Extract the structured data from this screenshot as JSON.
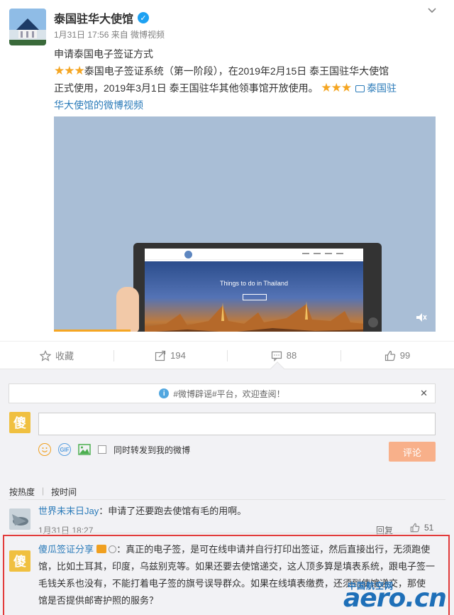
{
  "post": {
    "author": "泰国驻华大使馆",
    "meta": "1月31日 17:56 来自 微博视频",
    "title": "申请泰国电子签证方式",
    "text_line1": "泰国电子签证系统（第一阶段），在2019年2月15日 泰王国驻华大使馆",
    "text_line2": "正式使用，2019年3月1日 泰王国驻华其他领事馆开放使用。",
    "video_link_1": "泰国驻",
    "video_link_2": "华大使馆的微博视频",
    "video_hero_text": "Things to do in Thailand",
    "video_progress_fraction": 0.2
  },
  "actions": {
    "favorite": "收藏",
    "repost": "194",
    "comment": "88",
    "like": "99"
  },
  "comment_box": {
    "notice": "#微博辟谣#平台，欢迎查阅！",
    "sync_label": "同时转发到我的微博",
    "submit": "评论",
    "avatar_char": "傻"
  },
  "sort": {
    "hot": "按热度",
    "time": "按时间"
  },
  "comments": [
    {
      "user": "世界未末日Jay",
      "text": "：申请了还要跑去使馆有毛的用啊。",
      "time": "1月31日 18:27",
      "reply": "回复",
      "likes": "51"
    },
    {
      "user": "傻瓜签证分享",
      "avatar_char": "傻",
      "line1": "：真正的电子签，是可在线申请并自行打印出签证，然后直接出行，无须跑使",
      "line2": "馆，比如土耳其，印度，乌兹别克等。如果还要去使馆递交，这人顶多算是填表系统，跟电子签一",
      "line3": "毛钱关系也没有，不能打着电子签的旗号误导群众。如果在线填表缴费，还须到使馆递交，那使",
      "line4": "馆是否提供邮寄护照的服务？"
    }
  ],
  "watermark": {
    "top": "中国航空网",
    "main": "aero.cn"
  }
}
